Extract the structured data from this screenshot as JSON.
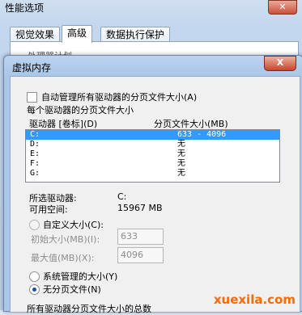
{
  "bg_window": {
    "title": "性能选项",
    "tabs": [
      "视觉效果",
      "高级",
      "数据执行保护"
    ],
    "group_text": "处理器计划"
  },
  "dialog": {
    "title": "虚拟内存",
    "close_label": "X",
    "auto_manage_label": "自动管理所有驱动器的分页文件大小(A)",
    "group_title": "每个驱动器的分页文件大小",
    "col_drive": "驱动器 [卷标](D)",
    "col_size": "分页文件大小(MB)",
    "drives": [
      {
        "drive": "C:",
        "size": "633 - 4096"
      },
      {
        "drive": "D:",
        "size": "无"
      },
      {
        "drive": "E:",
        "size": "无"
      },
      {
        "drive": "F:",
        "size": "无"
      },
      {
        "drive": "G:",
        "size": "无"
      }
    ],
    "selected_drive_label": "所选驱动器:",
    "selected_drive_value": "C:",
    "free_space_label": "可用空间:",
    "free_space_value": "15967 MB",
    "custom_size_label": "自定义大小(C):",
    "initial_size_label": "初始大小(MB)(I):",
    "initial_size_value": "633",
    "max_size_label": "最大值(MB)(X):",
    "max_size_value": "4096",
    "system_managed_label": "系统管理的大小(Y)",
    "no_paging_label": "无分页文件(N)",
    "total_label": "所有驱动器分页文件大小的总数"
  },
  "watermark": "xuexila.com"
}
